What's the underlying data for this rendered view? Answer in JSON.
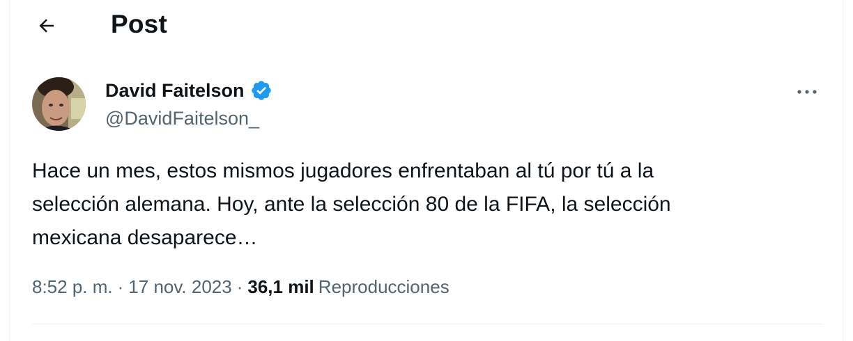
{
  "header": {
    "title": "Post",
    "back_icon": "arrow-left-icon"
  },
  "tweet": {
    "author": {
      "name": "David Faitelson",
      "handle": "@DavidFaitelson_",
      "verified_icon": "verified-badge-icon",
      "verified_color": "#1d9bf0"
    },
    "more_icon": "more-options-icon",
    "text_lines": [
      "Hace un mes, estos mismos jugadores enfrentaban al tú por tú a la",
      "selección alemana. Hoy, ante la selección 80 de la FIFA, la selección",
      "mexicana desaparece…"
    ],
    "meta": {
      "time": "8:52 p. m.",
      "separator": "·",
      "date": "17 nov. 2023",
      "views_count": "36,1 mil",
      "views_label": "Reproducciones"
    }
  },
  "colors": {
    "text_primary": "#0f1419",
    "text_secondary": "#536471",
    "border": "#eff3f4",
    "accent": "#1d9bf0"
  }
}
